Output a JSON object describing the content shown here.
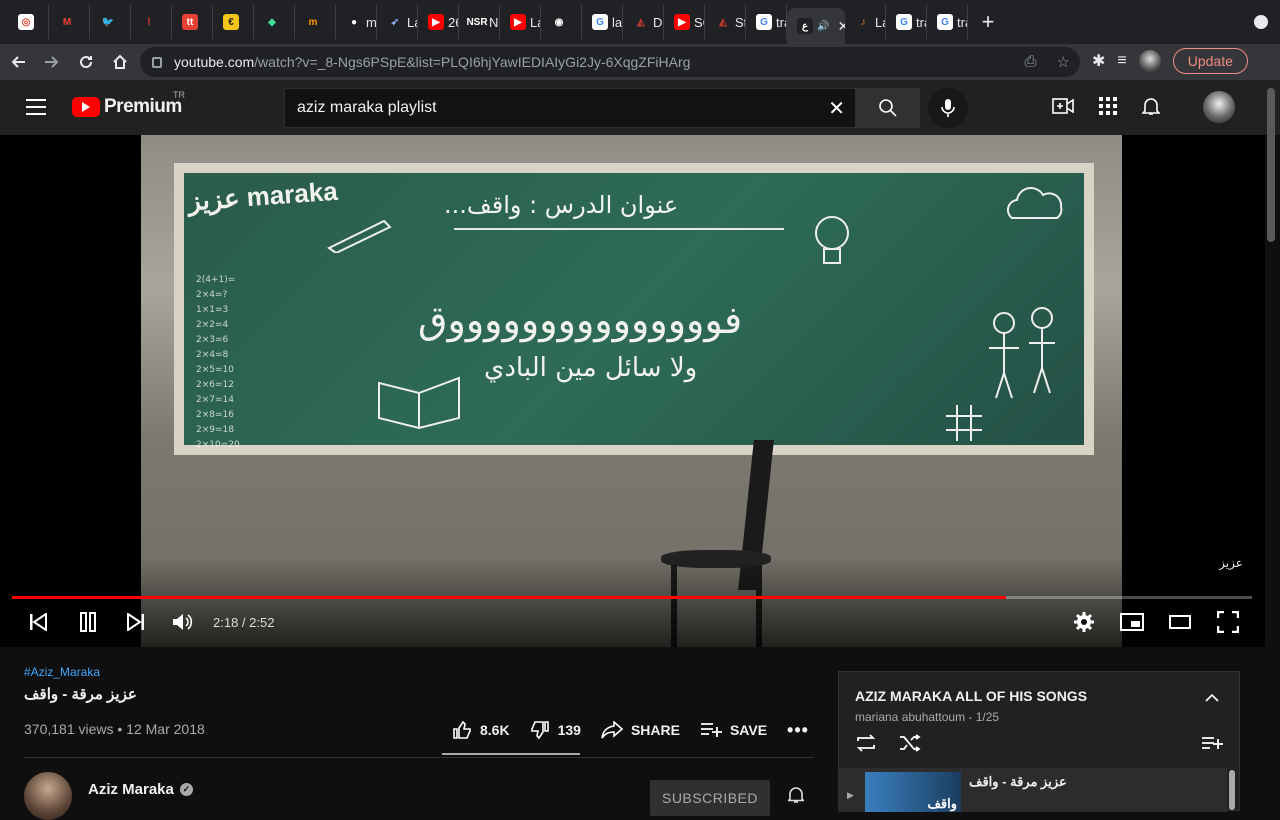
{
  "browser": {
    "tabs": [
      {
        "label": "",
        "color": "#ffffff",
        "glyph": "◎",
        "glyph_color": "#e94235"
      },
      {
        "label": "",
        "color": "#202124",
        "glyph": "M",
        "glyph_color": "#ea4335"
      },
      {
        "label": "",
        "color": "#202124",
        "glyph": "🐦",
        "glyph_color": "#1da1f2"
      },
      {
        "label": "",
        "color": "#202124",
        "glyph": "⌇",
        "glyph_color": "#c0392b"
      },
      {
        "label": "",
        "color": "#e94235",
        "glyph": "tt",
        "glyph_color": "#ffffff"
      },
      {
        "label": "",
        "color": "#f5c518",
        "glyph": "€",
        "glyph_color": "#202124"
      },
      {
        "label": "",
        "color": "#202124",
        "glyph": "◆",
        "glyph_color": "#3ddc97"
      },
      {
        "label": "",
        "color": "#202124",
        "glyph": "m",
        "glyph_color": "#ff9800"
      },
      {
        "label": "mu",
        "color": "#202124",
        "glyph": "●",
        "glyph_color": "#ffffff"
      },
      {
        "label": "Lar",
        "color": "#202124",
        "glyph": "➶",
        "glyph_color": "#8ab4f8"
      },
      {
        "label": "26",
        "color": "#ff0000",
        "glyph": "▶",
        "glyph_color": "#ffffff"
      },
      {
        "label": "NS",
        "color": "#202124",
        "glyph": "NSR",
        "glyph_color": "#ffffff"
      },
      {
        "label": "Lar",
        "color": "#ff0000",
        "glyph": "▶",
        "glyph_color": "#ffffff"
      },
      {
        "label": "",
        "color": "#202124",
        "glyph": "◉",
        "glyph_color": "#ffffff"
      },
      {
        "label": "lar",
        "color": "#ffffff",
        "glyph": "G",
        "glyph_color": "#4285f4"
      },
      {
        "label": "Da",
        "color": "#202124",
        "glyph": "◭",
        "glyph_color": "#c0392b"
      },
      {
        "label": "SC",
        "color": "#ff0000",
        "glyph": "▶",
        "glyph_color": "#ffffff"
      },
      {
        "label": "Sta",
        "color": "#202124",
        "glyph": "◭",
        "glyph_color": "#c0392b"
      },
      {
        "label": "tra",
        "color": "#ffffff",
        "glyph": "G",
        "glyph_color": "#4285f4"
      },
      {
        "label": "",
        "color": "#202124",
        "glyph": "ع",
        "glyph_color": "#ffffff",
        "active": true
      },
      {
        "label": "La",
        "color": "#202124",
        "glyph": "♪",
        "glyph_color": "#e67e22"
      },
      {
        "label": "tra",
        "color": "#ffffff",
        "glyph": "G",
        "glyph_color": "#4285f4"
      },
      {
        "label": "tra",
        "color": "#ffffff",
        "glyph": "G",
        "glyph_color": "#4285f4"
      }
    ],
    "url_host": "youtube.com",
    "url_path": "/watch?v=_8-Ngs6PSpE&list=PLQI6hjYawIEDIAIyGi2Jy-6XqgZFiHArg",
    "update_label": "Update"
  },
  "youtube": {
    "brand": "Premium",
    "country_code": "TR",
    "search_value": "aziz maraka playlist"
  },
  "player": {
    "time": "2:18 / 2:52",
    "progress": 0.802,
    "buffered": 0.805,
    "watermark": "عزيز",
    "board_logo": "عزيز maraka",
    "board_heading": "عنوان الدرس : واقف...",
    "board_main": "فوووووووووووووووق",
    "board_sub": "ولا سائل مين البادي"
  },
  "video": {
    "hashtag": "#Aziz_Maraka",
    "title": "عزيز مرقة - واقف",
    "views": "370,181 views • 12 Mar 2018",
    "likes": "8.6K",
    "dislikes": "139",
    "share_label": "SHARE",
    "save_label": "SAVE",
    "like_ratio": 0.984
  },
  "channel": {
    "name": "Aziz Maraka",
    "subscribe_label": "SUBSCRIBED"
  },
  "playlist": {
    "title": "AZIZ MARAKA ALL OF HIS SONGS",
    "subtitle": "mariana abuhattoum - 1/25",
    "current_item_title": "عزيز مرقة - واقف",
    "current_item_thumb_text": "واقف"
  },
  "colors": {
    "accent_red": "#ff0000",
    "link_blue": "#3ea6ff",
    "update_red": "#f28b82"
  }
}
